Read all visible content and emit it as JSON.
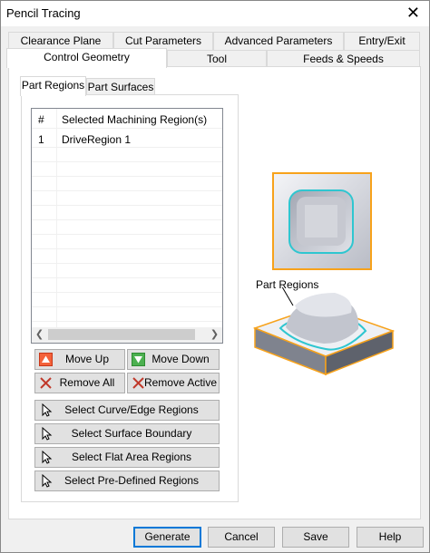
{
  "window": {
    "title": "Pencil Tracing"
  },
  "tabs_row1": [
    {
      "label": "Clearance Plane"
    },
    {
      "label": "Cut Parameters"
    },
    {
      "label": "Advanced Parameters"
    },
    {
      "label": "Entry/Exit"
    }
  ],
  "tabs_row2": [
    {
      "label": "Control Geometry",
      "active": true
    },
    {
      "label": "Tool"
    },
    {
      "label": "Feeds & Speeds"
    }
  ],
  "subtabs": [
    {
      "label": "Part Regions",
      "active": true
    },
    {
      "label": "Part Surfaces"
    }
  ],
  "regions_list": {
    "columns": [
      "#",
      "Selected Machining Region(s)"
    ],
    "rows": [
      {
        "num": "1",
        "name": "DriveRegion 1"
      }
    ]
  },
  "actions": {
    "move_up": "Move Up",
    "move_down": "Move Down",
    "remove_all": "Remove All",
    "remove_active": "Remove Active",
    "select_curve": "Select Curve/Edge Regions",
    "select_surface": "Select Surface Boundary",
    "select_flat": "Select Flat Area Regions",
    "select_predefined": "Select Pre-Defined Regions"
  },
  "preview": {
    "caption": "Part Regions",
    "accent": "#f7a21b",
    "highlight": "#2fc6d0"
  },
  "footer": {
    "generate": "Generate",
    "cancel": "Cancel",
    "save": "Save",
    "help": "Help"
  }
}
